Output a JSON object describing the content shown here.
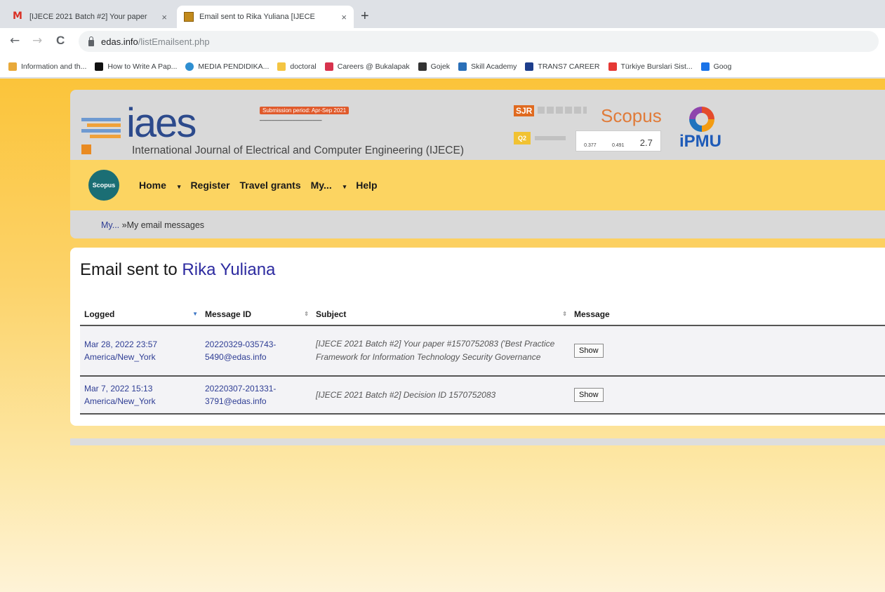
{
  "browser": {
    "tabs": [
      {
        "title": "[IJECE 2021 Batch #2] Your paper",
        "icon": "gmail-icon",
        "active": false
      },
      {
        "title": "Email sent to Rika Yuliana [IJECE",
        "icon": "edas-icon",
        "active": true
      }
    ],
    "new_tab_label": "+",
    "tab_close": "×",
    "url_host": "edas.info",
    "url_path": "/listEmailsent.php",
    "back_icon": "←",
    "forward_icon": "→",
    "reload_icon": "C",
    "bookmarks": [
      {
        "label": "Information and th...",
        "color": "#e8a93a"
      },
      {
        "label": "How to Write A Pap...",
        "color": "#111111"
      },
      {
        "label": "MEDIA PENDIDIKA...",
        "color": "#2f8fd1"
      },
      {
        "label": "doctoral",
        "color": "#f4c542"
      },
      {
        "label": "Careers @ Bukalapak",
        "color": "#d7334d"
      },
      {
        "label": "Gojek",
        "color": "#333333"
      },
      {
        "label": "Skill Academy",
        "color": "#2a6fb8"
      },
      {
        "label": "TRANS7 CAREER",
        "color": "#1d3e8c"
      },
      {
        "label": "Türkiye Burslari Sist...",
        "color": "#e53935"
      },
      {
        "label": "Goog",
        "color": "#1a73e8"
      }
    ]
  },
  "header": {
    "logo_text": "iaes",
    "journal_name": "International Journal of Electrical and Computer Engineering (IJECE)",
    "submission_badge": "Submission period: Apr-Sep 2021",
    "sjr": "SJR",
    "q2": "Q2",
    "scopus_word": "Scopus",
    "metric_1": "0.377",
    "metric_2": "0.491",
    "metric_3": "2.7",
    "ipmu": "iPMU"
  },
  "nav": {
    "scopus_badge": "Scopus",
    "items": [
      {
        "label": "Home",
        "caret": true
      },
      {
        "label": "Register",
        "caret": false
      },
      {
        "label": "Travel grants",
        "caret": false
      },
      {
        "label": "My...",
        "caret": true
      },
      {
        "label": "Help",
        "caret": false
      }
    ]
  },
  "breadcrumb": {
    "parent": "My...",
    "sep": " »",
    "current": "My email messages"
  },
  "main": {
    "heading_prefix": "Email sent to ",
    "heading_name": "Rika Yuliana",
    "columns": [
      "Logged",
      "Message ID",
      "Subject",
      "Message"
    ],
    "rows": [
      {
        "logged_line1": "Mar 28, 2022 23:57",
        "logged_line2": "America/New_York",
        "msgid_line1": "20220329-035743-",
        "msgid_line2": "5490@edas.info",
        "subject": "[IJECE 2021 Batch #2] Your paper #1570752083 ('Best Practice Framework for Information Technology Security Governance",
        "button": "Show"
      },
      {
        "logged_line1": "Mar 7, 2022 15:13",
        "logged_line2": "America/New_York",
        "msgid_line1": "20220307-201331-",
        "msgid_line2": "3791@edas.info",
        "subject": "[IJECE 2021 Batch #2] Decision ID 1570752083",
        "button": "Show"
      }
    ]
  }
}
